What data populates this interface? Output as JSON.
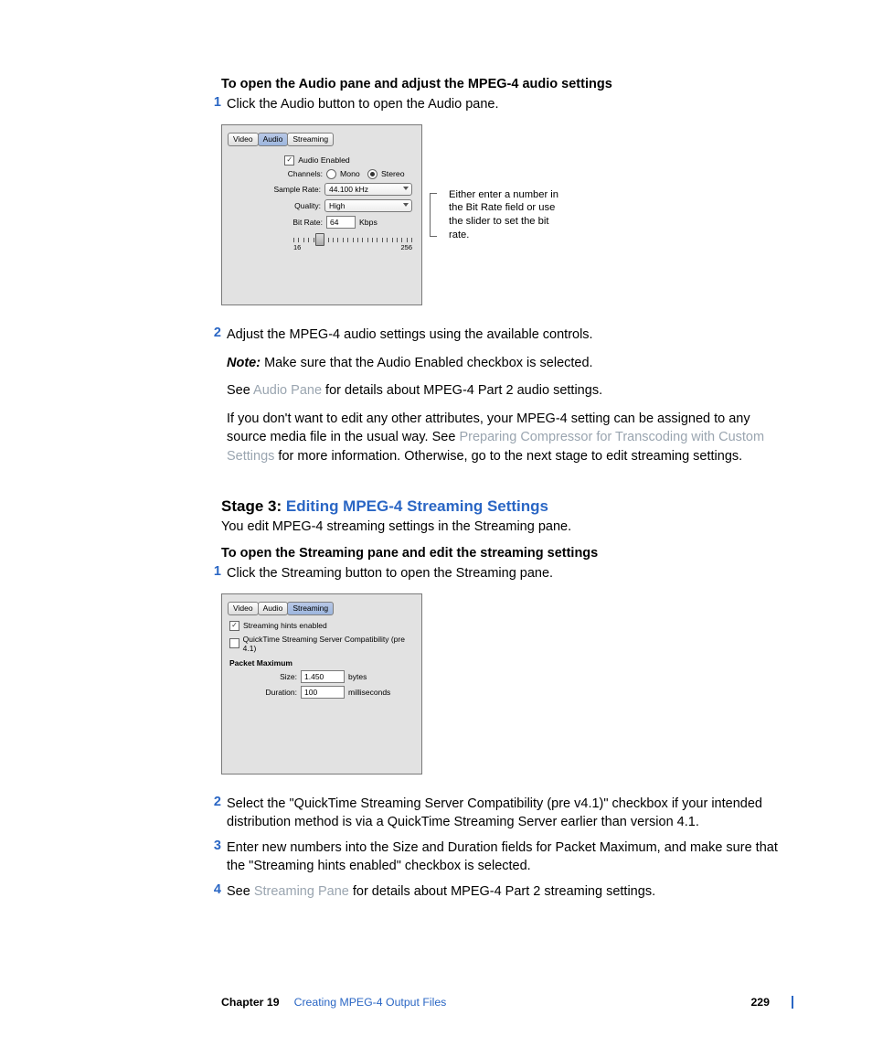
{
  "heading1": "To open the Audio pane and adjust the MPEG-4 audio settings",
  "step1_1": "Click the Audio button to open the Audio pane.",
  "audio_pane": {
    "tabs": {
      "video": "Video",
      "audio": "Audio",
      "streaming": "Streaming"
    },
    "enabled_label": "Audio Enabled",
    "channels_label": "Channels:",
    "mono": "Mono",
    "stereo": "Stereo",
    "samplerate_label": "Sample Rate:",
    "samplerate_value": "44.100 kHz",
    "quality_label": "Quality:",
    "quality_value": "High",
    "bitrate_label": "Bit Rate:",
    "bitrate_value": "64",
    "bitrate_unit": "Kbps",
    "slider_min": "16",
    "slider_max": "256"
  },
  "callout1": "Either enter a number in the Bit Rate field or use the slider to set the bit rate.",
  "step1_2_a": "Adjust the MPEG-4 audio settings using the available controls.",
  "note_label": "Note:",
  "note_body": "  Make sure that the Audio Enabled checkbox is selected.",
  "see_prefix": "See ",
  "audio_pane_link": "Audio Pane",
  "see_suffix": " for details about MPEG-4 Part 2 audio settings.",
  "para_if_a": "If you don't want to edit any other attributes, your MPEG-4 setting can be assigned to any source media file in the usual way. See ",
  "preparing_link": "Preparing Compressor for Transcoding with Custom Settings",
  "para_if_b": " for more information. Otherwise, go to the next stage to edit streaming settings.",
  "stage3_prefix": "Stage 3: ",
  "stage3_title": "Editing MPEG-4 Streaming Settings",
  "stage3_intro": "You edit MPEG-4 streaming settings in the Streaming pane.",
  "heading2": "To open the Streaming pane and edit the streaming settings",
  "step2_1": "Click the Streaming button to open the Streaming pane.",
  "streaming_pane": {
    "tabs": {
      "video": "Video",
      "audio": "Audio",
      "streaming": "Streaming"
    },
    "hints_label": "Streaming hints enabled",
    "compat_label": "QuickTime Streaming Server Compatibility (pre 4.1)",
    "packet_max": "Packet Maximum",
    "size_label": "Size:",
    "size_value": "1.450",
    "size_unit": "bytes",
    "duration_label": "Duration:",
    "duration_value": "100",
    "duration_unit": "milliseconds"
  },
  "step2_2": "Select the \"QuickTime Streaming Server Compatibility (pre v4.1)\" checkbox if your intended distribution method is via a QuickTime Streaming Server earlier than version 4.1.",
  "step2_3": "Enter new numbers into the Size and Duration fields for Packet Maximum, and make sure that the \"Streaming hints enabled\" checkbox is selected.",
  "step2_4_a": "See ",
  "streaming_pane_link": "Streaming Pane",
  "step2_4_b": " for details about MPEG-4 Part 2 streaming settings.",
  "footer": {
    "chapter": "Chapter 19",
    "title": "Creating MPEG-4 Output Files",
    "page": "229"
  }
}
